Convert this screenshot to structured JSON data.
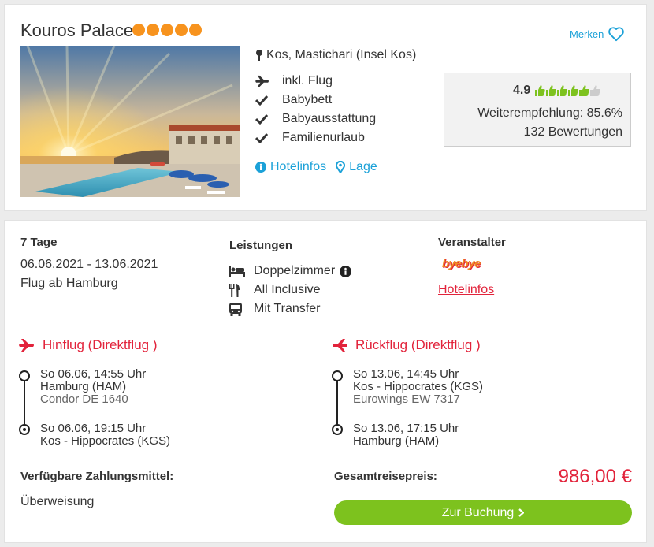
{
  "hotel": {
    "name": "Kouros Palace",
    "star_count": 5,
    "star_color": "#f7931e",
    "location": "Kos, Mastichari (Insel Kos)",
    "merken_label": "Merken",
    "features": [
      {
        "icon": "plane-icon",
        "label": "inkl. Flug"
      },
      {
        "icon": "check-icon",
        "label": "Babybett"
      },
      {
        "icon": "check-icon",
        "label": "Babyausstattung"
      },
      {
        "icon": "check-icon",
        "label": "Familienurlaub"
      }
    ],
    "links": {
      "hotelinfos": "Hotelinfos",
      "lage": "Lage"
    }
  },
  "rating": {
    "score": "4.9",
    "thumbs_filled": 5,
    "thumbs_total": 6,
    "recommendation": "Weiterempfehlung: 85.6%",
    "reviews": "132 Bewertungen"
  },
  "trip": {
    "duration": "7 Tage",
    "dates": "06.06.2021 - 13.06.2021",
    "departure": "Flug ab Hamburg"
  },
  "services": {
    "heading": "Leistungen",
    "items": [
      {
        "icon": "bed-icon",
        "label": "Doppelzimmer"
      },
      {
        "icon": "cutlery-icon",
        "label": "All Inclusive"
      },
      {
        "icon": "bus-icon",
        "label": "Mit Transfer"
      }
    ]
  },
  "operator": {
    "heading": "Veranstalter",
    "logo_text": "byebye",
    "link": "Hotelinfos"
  },
  "outbound": {
    "heading": "Hinflug (Direktflug )",
    "dep_time": "So 06.06, 14:55 Uhr",
    "dep_airport": "Hamburg (HAM)",
    "flight": "Condor DE 1640",
    "arr_time": "So 06.06, 19:15 Uhr",
    "arr_airport": "Kos - Hippocrates (KGS)"
  },
  "return": {
    "heading": "Rückflug (Direktflug )",
    "dep_time": "So 13.06, 14:45 Uhr",
    "dep_airport": "Kos - Hippocrates (KGS)",
    "flight": "Eurowings EW 7317",
    "arr_time": "So 13.06, 17:15 Uhr",
    "arr_airport": "Hamburg (HAM)"
  },
  "payment": {
    "heading": "Verfügbare Zahlungsmittel:",
    "method": "Überweisung"
  },
  "price": {
    "label": "Gesamtreisepreis:",
    "value": "986,00 €"
  },
  "booking": {
    "button_label": "Zur Buchung"
  },
  "colors": {
    "accent_blue": "#1ba1d8",
    "accent_red": "#e2233b",
    "button_green": "#7dc21e",
    "thumb_green": "#7dc21e"
  }
}
